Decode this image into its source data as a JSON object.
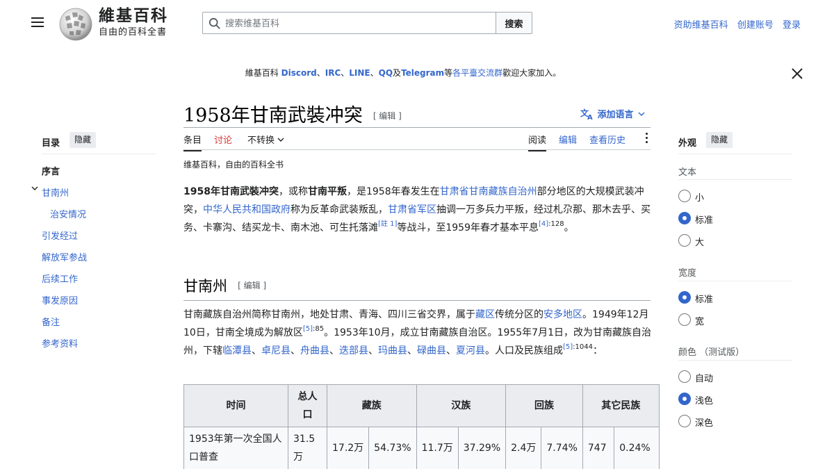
{
  "header": {
    "wordmark": "維基百科",
    "tagline": "自由的百科全書",
    "search_placeholder": "搜索维基百科",
    "search_button": "搜索",
    "user_links": [
      "资助维基百科",
      "创建账号",
      "登录"
    ]
  },
  "sitenotice": {
    "prefix": "維基百科 ",
    "discord": "Discord",
    "sep1": "、",
    "irc": "IRC",
    "sep2": "、",
    "line": "LINE",
    "sep3": "、",
    "qq": "QQ",
    "and": "及",
    "telegram": "Telegram",
    "etc": "等",
    "link": "各平臺交流群",
    "suffix": "歡迎大家加入。"
  },
  "toc": {
    "title": "目录",
    "hide": "隐藏",
    "items": [
      "序言",
      "甘南州",
      "治安情况",
      "引发经过",
      "解放军参战",
      "后续工作",
      "事发原因",
      "备注",
      "参考资料"
    ]
  },
  "page": {
    "title": "1958年甘南武裝冲突",
    "edit": "[ 编辑 ]",
    "add_languages": "添加语言",
    "tabs_left": [
      "条目",
      "讨论",
      "不转换"
    ],
    "tabs_right": [
      "阅读",
      "编辑",
      "查看历史"
    ],
    "tagline": "维基百科，自由的百科全书"
  },
  "intro": {
    "b1": "1958年甘南武裝冲突",
    "t1": "，或称",
    "b2": "甘南平叛",
    "t2": "，是1958年春发生在",
    "l1": "甘肃省",
    "l2": "甘南藏族自治州",
    "t3": "部分地区的大规模武装冲突，",
    "l3": "中华人民共和国政府",
    "t4": "称为反革命武装叛乱，",
    "l4": "甘肃省军区",
    "t5": "抽调一万多兵力平叛，经过札尕那、那木去乎、买务、卡寨沟、结买龙卡、南木池、可生托落滩",
    "ref1": "[註 1]",
    "t6": "等战斗，至1959年春才基本平息",
    "ref2": "[4]",
    "ref2_page": ":128",
    "t7": "。"
  },
  "section": {
    "heading": "甘南州",
    "edit": "[ 编辑 ]",
    "t1": "甘南藏族自治州简称甘南州，地处甘肃、青海、四川三省交界，属于",
    "l1": "藏区",
    "t2": "传统分区的",
    "l2": "安多地区",
    "t3": "。1949年12月10日，甘南全境成为解放区",
    "ref1": "[5]",
    "ref1_page": ":85",
    "t4": "。1953年10月，成立甘南藏族自治区。1955年7月1日，改为甘南藏族自治州，下辖",
    "counties": [
      "临潭县",
      "卓尼县",
      "舟曲县",
      "迭部县",
      "玛曲县",
      "碌曲县",
      "夏河县"
    ],
    "t5": "。人口及民族组成",
    "ref2": "[5]",
    "ref2_page": ":1044",
    "t6": "："
  },
  "table": {
    "headers": [
      "时间",
      "总人口",
      "藏族",
      "汉族",
      "回族",
      "其它民族"
    ],
    "row1": [
      "1953年第一次全国人口普查",
      "31.5万",
      "17.2万",
      "54.73%",
      "11.7万",
      "37.29%",
      "2.4万",
      "7.74%",
      "747",
      "0.24%"
    ]
  },
  "appearance": {
    "title": "外观",
    "hide": "隐藏",
    "text_label": "文本",
    "text_options": [
      "小",
      "标准",
      "大"
    ],
    "text_selected": "标准",
    "width_label": "宽度",
    "width_options": [
      "标准",
      "宽"
    ],
    "width_selected": "标准",
    "color_label": "颜色 （测试版）",
    "color_options": [
      "自动",
      "浅色",
      "深色"
    ],
    "color_selected": "浅色"
  },
  "colors": {
    "link": "#3366cc",
    "talk_red": "#dd3333",
    "text": "#202122"
  }
}
